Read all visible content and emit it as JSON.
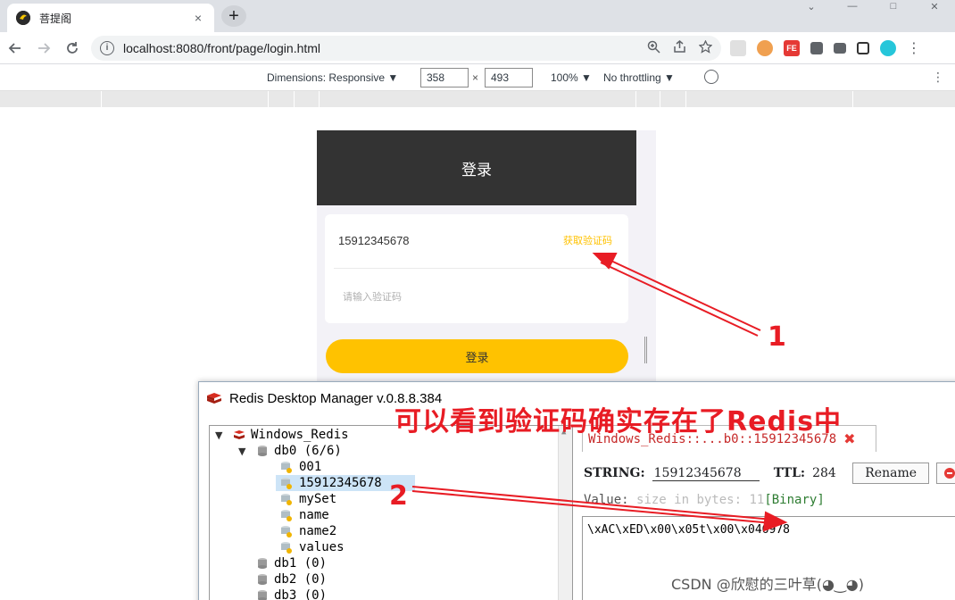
{
  "browser": {
    "tab_title": "菩提阁",
    "tab_close": "×",
    "new_tab": "+",
    "url": "localhost:8080/front/page/login.html",
    "win_min": "—",
    "win_max": "□",
    "win_close": "✕",
    "chevron": "⌄"
  },
  "devtools": {
    "dimensions_label": "Dimensions: Responsive ▼",
    "width": "358",
    "height": "493",
    "times": "×",
    "zoom": "100% ▼",
    "throttle": "No throttling ▼",
    "more": "⋮"
  },
  "page": {
    "header_title": "登录",
    "phone_value": "15912345678",
    "get_code": "获取验证码",
    "code_placeholder": "请输入验证码",
    "login_button": "登录"
  },
  "rdm": {
    "title": "Redis Desktop Manager v.0.8.8.384",
    "tree": {
      "connection": "Windows_Redis",
      "db0": "db0  (6/6)",
      "keys": [
        "001",
        "15912345678",
        "mySet",
        "name",
        "name2",
        "values"
      ],
      "db1": "db1 (0)",
      "db2": "db2 (0)",
      "db3": "db3 (0)"
    },
    "tab_label": "Windows_Redis::...b0::15912345678",
    "tab_close": "✖",
    "type_label": "STRING:",
    "key_value": "15912345678",
    "ttl_label": "TTL:",
    "ttl_value": "284",
    "rename_button": "Rename",
    "value_label": "Value:",
    "size_text": "size in bytes: 11",
    "binary_tag": "[Binary]",
    "value_content": "\\xAC\\xED\\x00\\x05t\\x00\\x046978"
  },
  "annotations": {
    "headline": "可以看到验证码确实存在了Redis中",
    "num1": "1",
    "num2": "2",
    "watermark": "CSDN @欣慰的三叶草(◕‿◕)",
    "color": "#e81c24"
  }
}
